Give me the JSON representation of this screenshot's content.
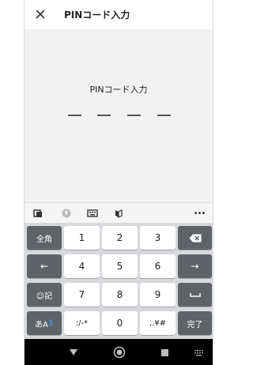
{
  "header": {
    "title": "PINコード入力",
    "close_icon": "close-icon"
  },
  "pin": {
    "label": "PINコード入力",
    "digits": 4,
    "entered": 0
  },
  "keyboard_toolbar": {
    "icons": [
      "keyboard-switch-icon",
      "microphone-icon",
      "keyboard-layout-icon",
      "beginner-mark-icon",
      "more-icon"
    ],
    "more_label": "•••"
  },
  "keyboard": {
    "row1": {
      "left": "全角",
      "k1": "1",
      "k2": "2",
      "k3": "3"
    },
    "row2": {
      "left": "←",
      "k1": "4",
      "k2": "5",
      "k3": "6",
      "right": "→"
    },
    "row3": {
      "left": "☺記",
      "k1": "7",
      "k2": "8",
      "k3": "9"
    },
    "row4": {
      "left_a": "あA",
      "left_b": "1",
      "k1": ":/-*",
      "k2": "0",
      "k3": ",.¥#",
      "right": "完了"
    }
  },
  "nav": {
    "icons": [
      "back-triangle-icon",
      "home-circle-icon",
      "recents-square-icon",
      "keyboard-hide-icon"
    ]
  },
  "colors": {
    "key_light": "#ffffff",
    "key_dark": "#5f6368",
    "keyboard_bg": "#d7d9dc",
    "accent_blue": "#4a90e2"
  }
}
